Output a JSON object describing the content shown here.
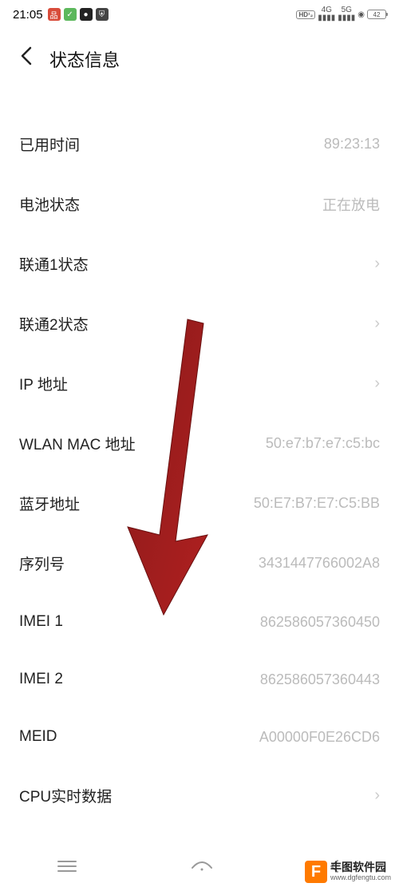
{
  "status_bar": {
    "time": "21:05",
    "hd_label": "HD",
    "sim1_net": "4G",
    "sim2_net": "5G",
    "battery_label": "42"
  },
  "header": {
    "title": "状态信息"
  },
  "rows": {
    "uptime": {
      "label": "已用时间",
      "value": "89:23:13"
    },
    "battery": {
      "label": "电池状态",
      "value": "正在放电"
    },
    "sim1": {
      "label": "联通1状态",
      "value": ""
    },
    "sim2": {
      "label": "联通2状态",
      "value": ""
    },
    "ip": {
      "label": "IP 地址",
      "value": ""
    },
    "wlan_mac": {
      "label": "WLAN MAC 地址",
      "value": "50:e7:b7:e7:c5:bc"
    },
    "bt_addr": {
      "label": "蓝牙地址",
      "value": "50:E7:B7:E7:C5:BB"
    },
    "serial": {
      "label": "序列号",
      "value": "3431447766002A8"
    },
    "imei1": {
      "label": "IMEI 1",
      "value": "862586057360450"
    },
    "imei2": {
      "label": "IMEI 2",
      "value": "862586057360443"
    },
    "meid": {
      "label": "MEID",
      "value": "A00000F0E26CD6"
    },
    "cpu": {
      "label": "CPU实时数据",
      "value": ""
    }
  },
  "watermark": {
    "logo_letter": "F",
    "text": "丰图软件园",
    "url": "www.dgfengtu.com"
  }
}
